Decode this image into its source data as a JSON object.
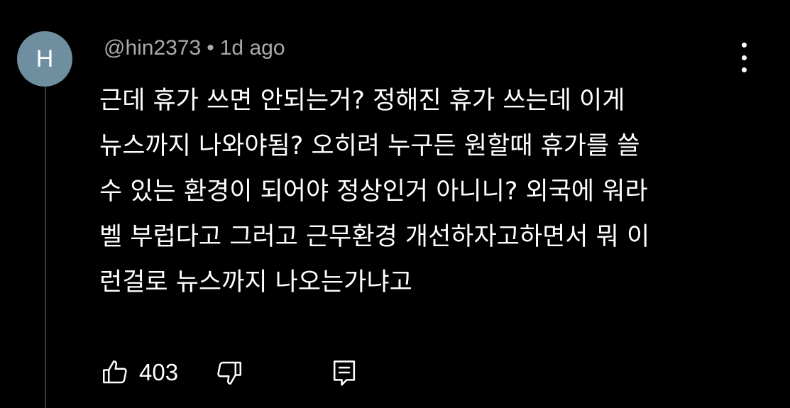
{
  "comment": {
    "avatar_letter": "H",
    "author": "@hin2373",
    "separator": "•",
    "time": "1d ago",
    "lines": [
      "근데 휴가 쓰면 안되는거? 정해진 휴가 쓰는데 이게",
      "뉴스까지 나와야됨? 오히려 누구든 원할때 휴가를 쓸",
      "수 있는 환경이 되어야 정상인거 아니니? 외국에 워라",
      "벨 부럽다고 그러고 근무환경 개선하자고하면서 뭐 이",
      "런걸로 뉴스까지 나오는가냐고"
    ],
    "like_count": "403"
  },
  "icons": {
    "avatar": "avatar",
    "more": "more-vert-icon",
    "like": "thumb-up-icon",
    "dislike": "thumb-down-icon",
    "reply": "comment-reply-icon"
  },
  "colors": {
    "background": "#000000",
    "avatar": "#6f8fa1",
    "meta_text": "#aaaaaa",
    "body_text": "#ffffff"
  }
}
